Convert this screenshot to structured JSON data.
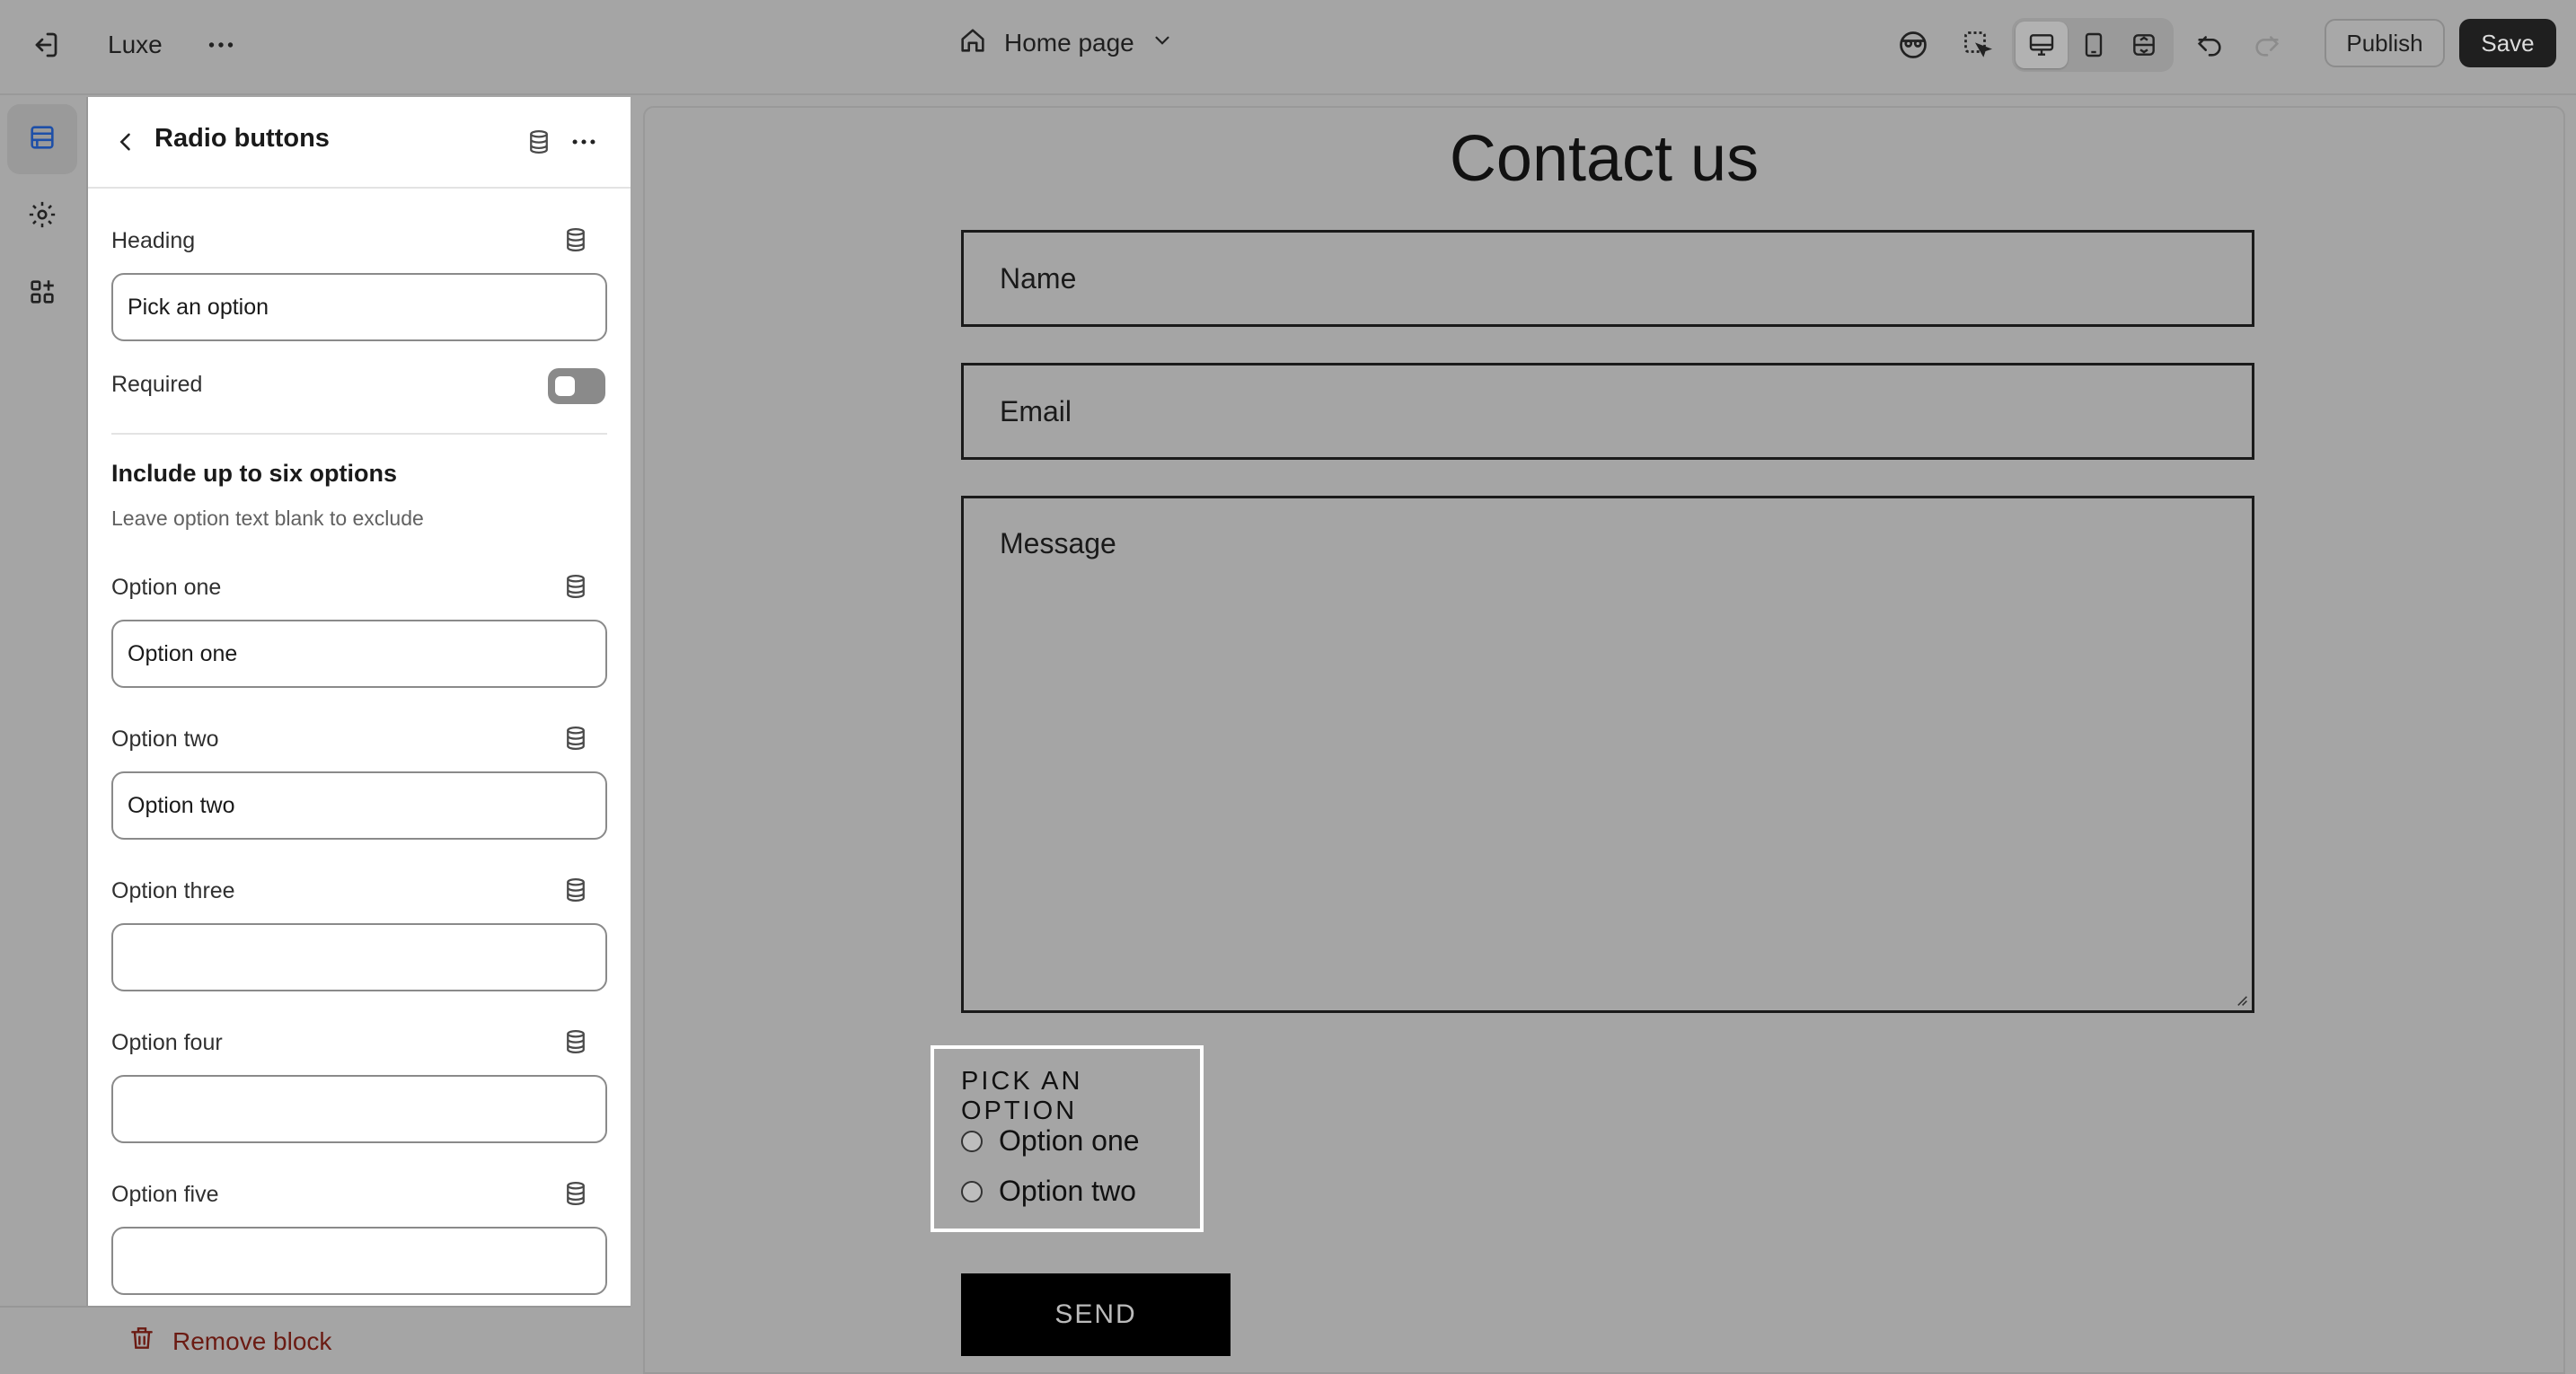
{
  "topbar": {
    "store_name": "Luxe",
    "page_picker": "Home page",
    "publish_label": "Publish",
    "save_label": "Save"
  },
  "panel": {
    "title": "Radio buttons",
    "heading_label": "Heading",
    "heading_value": "Pick an option",
    "required_label": "Required",
    "required_on": false,
    "section_heading": "Include up to six options",
    "section_help": "Leave option text blank to exclude",
    "options": [
      {
        "label": "Option one",
        "value": "Option one"
      },
      {
        "label": "Option two",
        "value": "Option two"
      },
      {
        "label": "Option three",
        "value": ""
      },
      {
        "label": "Option four",
        "value": ""
      },
      {
        "label": "Option five",
        "value": ""
      }
    ],
    "remove_block": "Remove block"
  },
  "preview": {
    "heading": "Contact us",
    "name_placeholder": "Name",
    "email_placeholder": "Email",
    "message_placeholder": "Message",
    "radio_heading": "PICK AN OPTION",
    "radio_options": [
      "Option one",
      "Option two"
    ],
    "send_label": "SEND"
  }
}
